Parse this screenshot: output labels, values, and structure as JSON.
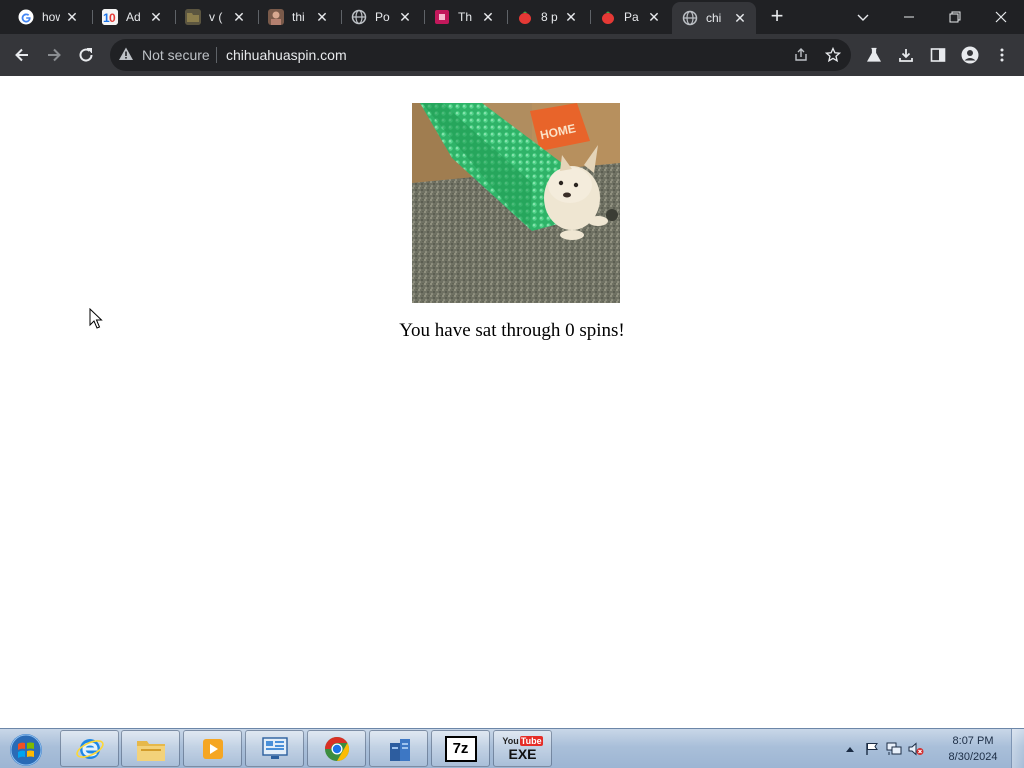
{
  "browser": {
    "tabs": [
      {
        "title": "how",
        "favicon": "google-icon",
        "active": false
      },
      {
        "title": "Ad",
        "favicon": "ten-badge-icon",
        "active": false
      },
      {
        "title": "v (",
        "favicon": "folder-thumbnail-icon",
        "active": false
      },
      {
        "title": "thi",
        "favicon": "photo-thumbnail-icon",
        "active": false
      },
      {
        "title": "Po",
        "favicon": "globe-icon",
        "active": false
      },
      {
        "title": "Th",
        "favicon": "pink-square-icon",
        "active": false
      },
      {
        "title": "8 p",
        "favicon": "red-fruit-icon",
        "active": false
      },
      {
        "title": "Pa",
        "favicon": "red-fruit-icon",
        "active": false
      },
      {
        "title": "chi",
        "favicon": "globe-icon",
        "active": true
      }
    ],
    "close_glyph": "✕",
    "new_tab_glyph": "+",
    "security_label": "Not secure",
    "url": "chihuahuaspin.com"
  },
  "page": {
    "image_alt": "chihuahua-in-bubble-wrap",
    "spin_text": "You have sat through 0 spins!"
  },
  "taskbar": {
    "time": "8:07 PM",
    "date": "8/30/2024",
    "items": [
      "ie-icon",
      "file-explorer-icon",
      "media-player-icon",
      "control-panel-icon",
      "chrome-icon",
      "server-manager-icon",
      "7zip-icon",
      "youtube-exe-icon"
    ],
    "sevenzip_label": "7z",
    "youtube_label": "You",
    "exe_label": "EXE"
  },
  "colors": {
    "tabstrip_bg": "#202124",
    "toolbar_bg": "#35363a",
    "omnibox_bg": "#202124",
    "page_bg": "#ffffff"
  }
}
